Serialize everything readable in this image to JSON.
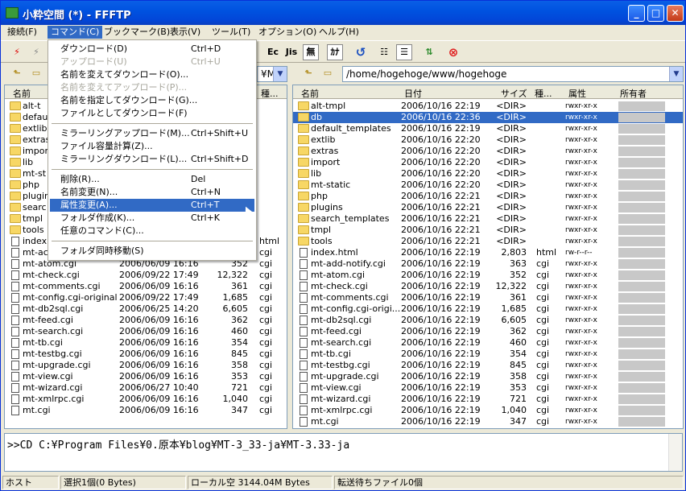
{
  "window": {
    "title": "小粋空間 (*) - FFFTP"
  },
  "menubar": [
    "接続(F)",
    "コマンド(C)",
    "ブックマーク(B)",
    "表示(V)",
    "ツール(T)",
    "オプション(O)",
    "ヘルプ(H)"
  ],
  "toolbar": {
    "ec": "Ec",
    "js": "Jis",
    "mu": "無",
    "ka": "ｶﾅ"
  },
  "left": {
    "path_fragment": "¥MT",
    "headers": {
      "name": "名前",
      "type": "種..."
    },
    "folders": [
      "alt-t",
      "defau",
      "extlib",
      "extras",
      "impor",
      "lib",
      "mt-st",
      "php",
      "plugin",
      "searc",
      "tmpl",
      "tools"
    ],
    "files": [
      {
        "name": "index.",
        "date": "",
        "size": "",
        "type": "html"
      },
      {
        "name": "mt-ac",
        "date": "",
        "size": "",
        "type": "cgi"
      },
      {
        "name": "mt-atom.cgi",
        "date": "2006/06/09 16:16",
        "size": "352",
        "type": "cgi"
      },
      {
        "name": "mt-check.cgi",
        "date": "2006/09/22 17:49",
        "size": "12,322",
        "type": "cgi"
      },
      {
        "name": "mt-comments.cgi",
        "date": "2006/06/09 16:16",
        "size": "361",
        "type": "cgi"
      },
      {
        "name": "mt-config.cgi-original",
        "date": "2006/09/22 17:49",
        "size": "1,685",
        "type": "cgi"
      },
      {
        "name": "mt-db2sql.cgi",
        "date": "2006/06/25 14:20",
        "size": "6,605",
        "type": "cgi"
      },
      {
        "name": "mt-feed.cgi",
        "date": "2006/06/09 16:16",
        "size": "362",
        "type": "cgi"
      },
      {
        "name": "mt-search.cgi",
        "date": "2006/06/09 16:16",
        "size": "460",
        "type": "cgi"
      },
      {
        "name": "mt-tb.cgi",
        "date": "2006/06/09 16:16",
        "size": "354",
        "type": "cgi"
      },
      {
        "name": "mt-testbg.cgi",
        "date": "2006/06/09 16:16",
        "size": "845",
        "type": "cgi"
      },
      {
        "name": "mt-upgrade.cgi",
        "date": "2006/06/09 16:16",
        "size": "358",
        "type": "cgi"
      },
      {
        "name": "mt-view.cgi",
        "date": "2006/06/09 16:16",
        "size": "353",
        "type": "cgi"
      },
      {
        "name": "mt-wizard.cgi",
        "date": "2006/06/27 10:40",
        "size": "721",
        "type": "cgi"
      },
      {
        "name": "mt-xmlrpc.cgi",
        "date": "2006/06/09 16:16",
        "size": "1,040",
        "type": "cgi"
      },
      {
        "name": "mt.cgi",
        "date": "2006/06/09 16:16",
        "size": "347",
        "type": "cgi"
      }
    ]
  },
  "right": {
    "path": "/home/hogehoge/www/hogehoge",
    "headers": {
      "name": "名前",
      "date": "日付",
      "size": "サイズ",
      "type": "種...",
      "attr": "属性",
      "owner": "所有者"
    },
    "rows": [
      {
        "kind": "folder",
        "name": "alt-tmpl",
        "date": "2006/10/16 22:19",
        "size": "<DIR>",
        "type": "",
        "attr": "rwxr-xr-x"
      },
      {
        "kind": "folder",
        "name": "db",
        "date": "2006/10/16 22:36",
        "size": "<DIR>",
        "type": "",
        "attr": "rwxr-xr-x",
        "selected": true
      },
      {
        "kind": "folder",
        "name": "default_templates",
        "date": "2006/10/16 22:19",
        "size": "<DIR>",
        "type": "",
        "attr": "rwxr-xr-x"
      },
      {
        "kind": "folder",
        "name": "extlib",
        "date": "2006/10/16 22:20",
        "size": "<DIR>",
        "type": "",
        "attr": "rwxr-xr-x"
      },
      {
        "kind": "folder",
        "name": "extras",
        "date": "2006/10/16 22:20",
        "size": "<DIR>",
        "type": "",
        "attr": "rwxr-xr-x"
      },
      {
        "kind": "folder",
        "name": "import",
        "date": "2006/10/16 22:20",
        "size": "<DIR>",
        "type": "",
        "attr": "rwxr-xr-x"
      },
      {
        "kind": "folder",
        "name": "lib",
        "date": "2006/10/16 22:20",
        "size": "<DIR>",
        "type": "",
        "attr": "rwxr-xr-x"
      },
      {
        "kind": "folder",
        "name": "mt-static",
        "date": "2006/10/16 22:20",
        "size": "<DIR>",
        "type": "",
        "attr": "rwxr-xr-x"
      },
      {
        "kind": "folder",
        "name": "php",
        "date": "2006/10/16 22:21",
        "size": "<DIR>",
        "type": "",
        "attr": "rwxr-xr-x"
      },
      {
        "kind": "folder",
        "name": "plugins",
        "date": "2006/10/16 22:21",
        "size": "<DIR>",
        "type": "",
        "attr": "rwxr-xr-x"
      },
      {
        "kind": "folder",
        "name": "search_templates",
        "date": "2006/10/16 22:21",
        "size": "<DIR>",
        "type": "",
        "attr": "rwxr-xr-x"
      },
      {
        "kind": "folder",
        "name": "tmpl",
        "date": "2006/10/16 22:21",
        "size": "<DIR>",
        "type": "",
        "attr": "rwxr-xr-x"
      },
      {
        "kind": "folder",
        "name": "tools",
        "date": "2006/10/16 22:21",
        "size": "<DIR>",
        "type": "",
        "attr": "rwxr-xr-x"
      },
      {
        "kind": "file",
        "name": "index.html",
        "date": "2006/10/16 22:19",
        "size": "2,803",
        "type": "html",
        "attr": "rw-r--r--"
      },
      {
        "kind": "file",
        "name": "mt-add-notify.cgi",
        "date": "2006/10/16 22:19",
        "size": "363",
        "type": "cgi",
        "attr": "rwxr-xr-x"
      },
      {
        "kind": "file",
        "name": "mt-atom.cgi",
        "date": "2006/10/16 22:19",
        "size": "352",
        "type": "cgi",
        "attr": "rwxr-xr-x"
      },
      {
        "kind": "file",
        "name": "mt-check.cgi",
        "date": "2006/10/16 22:19",
        "size": "12,322",
        "type": "cgi",
        "attr": "rwxr-xr-x"
      },
      {
        "kind": "file",
        "name": "mt-comments.cgi",
        "date": "2006/10/16 22:19",
        "size": "361",
        "type": "cgi",
        "attr": "rwxr-xr-x"
      },
      {
        "kind": "file",
        "name": "mt-config.cgi-origi...",
        "date": "2006/10/16 22:19",
        "size": "1,685",
        "type": "cgi",
        "attr": "rwxr-xr-x"
      },
      {
        "kind": "file",
        "name": "mt-db2sql.cgi",
        "date": "2006/10/16 22:19",
        "size": "6,605",
        "type": "cgi",
        "attr": "rwxr-xr-x"
      },
      {
        "kind": "file",
        "name": "mt-feed.cgi",
        "date": "2006/10/16 22:19",
        "size": "362",
        "type": "cgi",
        "attr": "rwxr-xr-x"
      },
      {
        "kind": "file",
        "name": "mt-search.cgi",
        "date": "2006/10/16 22:19",
        "size": "460",
        "type": "cgi",
        "attr": "rwxr-xr-x"
      },
      {
        "kind": "file",
        "name": "mt-tb.cgi",
        "date": "2006/10/16 22:19",
        "size": "354",
        "type": "cgi",
        "attr": "rwxr-xr-x"
      },
      {
        "kind": "file",
        "name": "mt-testbg.cgi",
        "date": "2006/10/16 22:19",
        "size": "845",
        "type": "cgi",
        "attr": "rwxr-xr-x"
      },
      {
        "kind": "file",
        "name": "mt-upgrade.cgi",
        "date": "2006/10/16 22:19",
        "size": "358",
        "type": "cgi",
        "attr": "rwxr-xr-x"
      },
      {
        "kind": "file",
        "name": "mt-view.cgi",
        "date": "2006/10/16 22:19",
        "size": "353",
        "type": "cgi",
        "attr": "rwxr-xr-x"
      },
      {
        "kind": "file",
        "name": "mt-wizard.cgi",
        "date": "2006/10/16 22:19",
        "size": "721",
        "type": "cgi",
        "attr": "rwxr-xr-x"
      },
      {
        "kind": "file",
        "name": "mt-xmlrpc.cgi",
        "date": "2006/10/16 22:19",
        "size": "1,040",
        "type": "cgi",
        "attr": "rwxr-xr-x"
      },
      {
        "kind": "file",
        "name": "mt.cgi",
        "date": "2006/10/16 22:19",
        "size": "347",
        "type": "cgi",
        "attr": "rwxr-xr-x"
      }
    ]
  },
  "menu": [
    {
      "label": "ダウンロード(D)",
      "key": "Ctrl+D"
    },
    {
      "label": "アップロード(U)",
      "key": "Ctrl+U",
      "disabled": true
    },
    {
      "label": "名前を変えてダウンロード(O)...",
      "key": ""
    },
    {
      "label": "名前を変えてアップロード(P)...",
      "key": "",
      "disabled": true
    },
    {
      "label": "名前を指定してダウンロード(G)...",
      "key": ""
    },
    {
      "label": "ファイルとしてダウンロード(F)",
      "key": ""
    },
    {
      "sep": true
    },
    {
      "label": "ミラーリングアップロード(M)...",
      "key": "Ctrl+Shift+U"
    },
    {
      "label": "ファイル容量計算(Z)...",
      "key": ""
    },
    {
      "label": "ミラーリングダウンロード(L)...",
      "key": "Ctrl+Shift+D"
    },
    {
      "sep": true
    },
    {
      "label": "削除(R)...",
      "key": "Del"
    },
    {
      "label": "名前変更(N)...",
      "key": "Ctrl+N"
    },
    {
      "label": "属性変更(A)...",
      "key": "Ctrl+T",
      "highlighted": true
    },
    {
      "label": "フォルダ作成(K)...",
      "key": "Ctrl+K"
    },
    {
      "label": "任意のコマンド(C)...",
      "key": ""
    },
    {
      "sep": true
    },
    {
      "label": "フォルダ同時移動(S)",
      "key": ""
    }
  ],
  "log": {
    "text": ">>CD C:¥Program Files¥0.原本¥blog¥MT-3_33-ja¥MT-3.33-ja"
  },
  "status": {
    "host": "ホスト",
    "selection": "選択1個(0 Bytes)",
    "local_free": "ローカル空 3144.04M Bytes",
    "queue": "転送待ちファイル0個"
  }
}
